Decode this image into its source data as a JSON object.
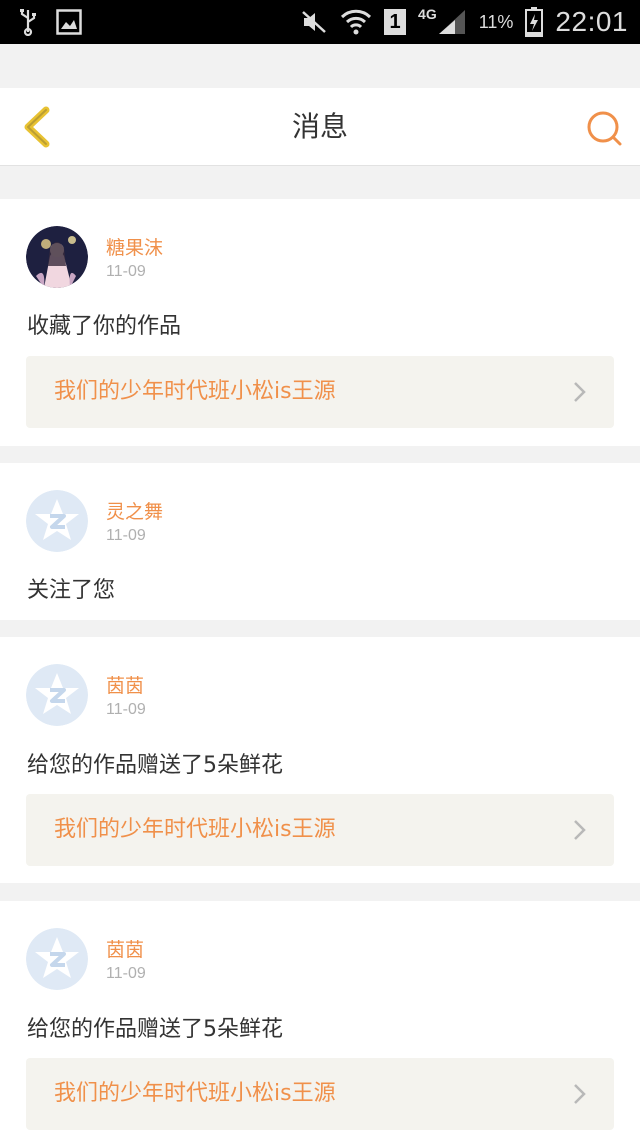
{
  "status_bar": {
    "network": "4G",
    "sim": "1",
    "battery": "11%",
    "time": "22:01"
  },
  "header": {
    "title": "消息",
    "back_icon": "back-chevron-icon",
    "search_icon": "search-icon"
  },
  "colors": {
    "accent": "#f0904a",
    "back": "#e8c232",
    "card_link_bg": "#f4f3ee"
  },
  "messages": [
    {
      "username": "糖果沫",
      "date": "11-09",
      "action": "收藏了你的作品",
      "work_title": "我们的少年时代班小松is王源",
      "avatar": "user-photo"
    },
    {
      "username": "灵之舞",
      "date": "11-09",
      "action": "关注了您",
      "avatar": "default-avatar"
    },
    {
      "username": "茵茵",
      "date": "11-09",
      "action": "给您的作品赠送了5朵鲜花",
      "work_title": "我们的少年时代班小松is王源",
      "avatar": "default-avatar"
    },
    {
      "username": "茵茵",
      "date": "11-09",
      "action": "给您的作品赠送了5朵鲜花",
      "work_title": "我们的少年时代班小松is王源",
      "avatar": "default-avatar"
    }
  ]
}
